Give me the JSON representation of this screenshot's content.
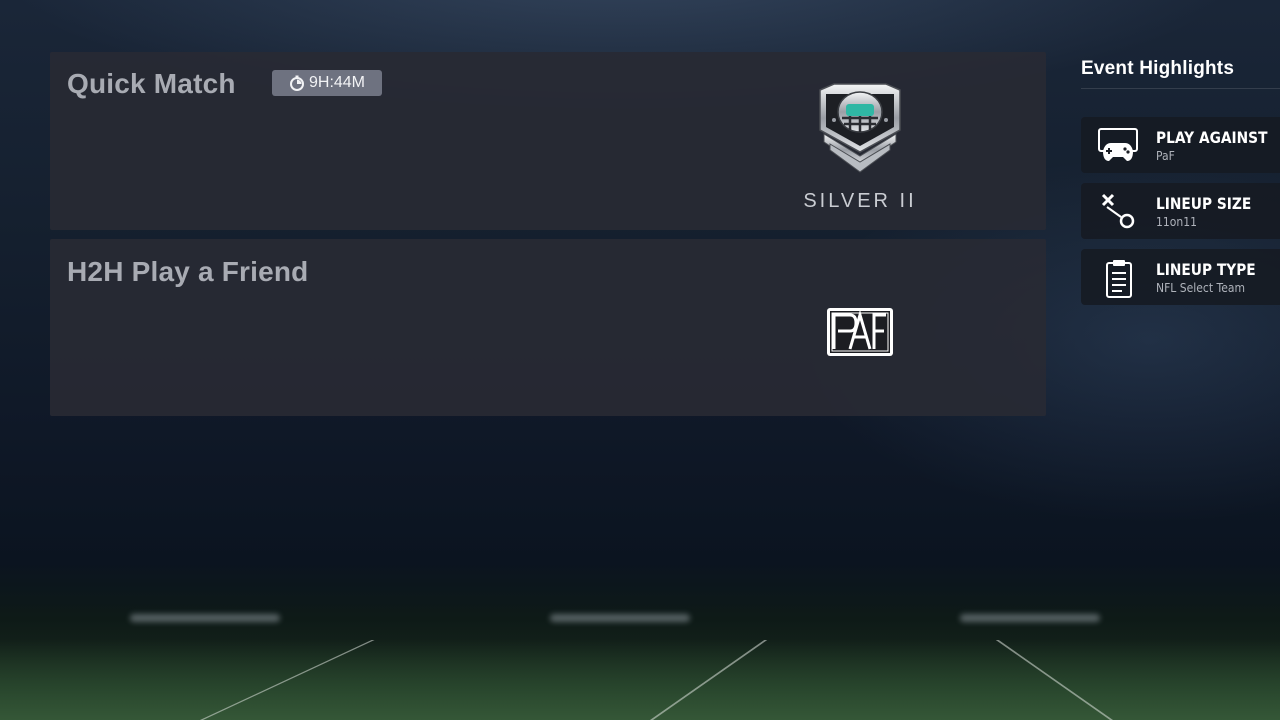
{
  "events": [
    {
      "title": "Quick Match",
      "timer": "9H:44M",
      "rank": "SILVER II"
    },
    {
      "title": "H2H Play a Friend"
    }
  ],
  "sidebar": {
    "title": "Event Highlights",
    "items": [
      {
        "label": "PLAY AGAINST",
        "value": "PaF",
        "icon": "controller-icon"
      },
      {
        "label": "LINEUP SIZE",
        "value": "11on11",
        "icon": "x-o-play-icon"
      },
      {
        "label": "LINEUP TYPE",
        "value": "NFL Select Team",
        "icon": "clipboard-icon"
      }
    ]
  }
}
